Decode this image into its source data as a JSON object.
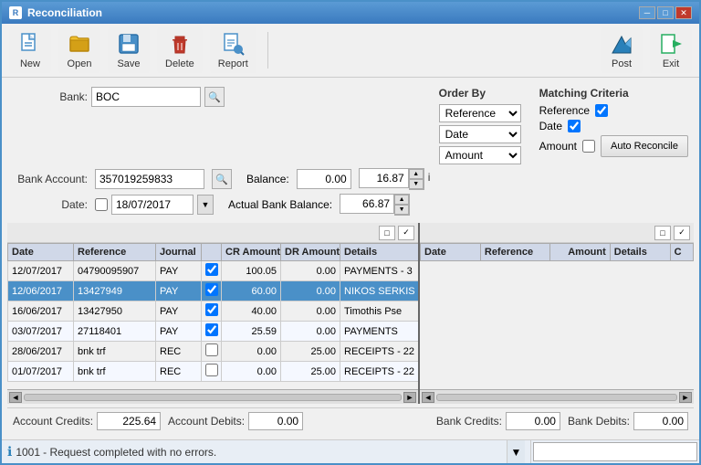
{
  "window": {
    "title": "Reconciliation"
  },
  "toolbar": {
    "new_label": "New",
    "open_label": "Open",
    "save_label": "Save",
    "delete_label": "Delete",
    "report_label": "Report",
    "post_label": "Post",
    "exit_label": "Exit"
  },
  "form": {
    "bank_label": "Bank:",
    "bank_value": "BOC",
    "bank_account_label": "Bank Account:",
    "bank_account_value": "357019259833",
    "date_label": "Date:",
    "date_value": "18/07/2017",
    "balance_label": "Balance:",
    "balance_value": "0.00",
    "balance_value2": "16.87",
    "actual_bank_balance_label": "Actual Bank Balance:",
    "actual_bank_balance_value": "66.87"
  },
  "order_by": {
    "title": "Order By",
    "options": [
      "Reference",
      "Date",
      "Amount"
    ],
    "selected": [
      "Reference",
      "Date",
      "Amount"
    ]
  },
  "matching_criteria": {
    "title": "Matching Criteria",
    "items": [
      {
        "label": "Reference",
        "checked": true
      },
      {
        "label": "Date",
        "checked": true
      },
      {
        "label": "Amount",
        "checked": false
      }
    ],
    "auto_reconcile_label": "Auto Reconcile"
  },
  "left_table": {
    "headers": [
      "Date",
      "Reference",
      "Journal",
      "",
      "CR Amount",
      "DR Amount",
      "Details"
    ],
    "rows": [
      {
        "date": "12/07/2017",
        "reference": "04790095907",
        "journal": "PAY",
        "checked": true,
        "cr_amount": "100.05",
        "dr_amount": "0.00",
        "details": "PAYMENTS - 3",
        "selected": false
      },
      {
        "date": "12/06/2017",
        "reference": "13427949",
        "journal": "PAY",
        "checked": true,
        "cr_amount": "60.00",
        "dr_amount": "0.00",
        "details": "NIKOS SERKIS",
        "selected": true
      },
      {
        "date": "16/06/2017",
        "reference": "13427950",
        "journal": "PAY",
        "checked": true,
        "cr_amount": "40.00",
        "dr_amount": "0.00",
        "details": "Timothis Pse",
        "selected": false
      },
      {
        "date": "03/07/2017",
        "reference": "27118401",
        "journal": "PAY",
        "checked": true,
        "cr_amount": "25.59",
        "dr_amount": "0.00",
        "details": "PAYMENTS",
        "selected": false
      },
      {
        "date": "28/06/2017",
        "reference": "bnk trf",
        "journal": "REC",
        "checked": false,
        "cr_amount": "0.00",
        "dr_amount": "25.00",
        "details": "RECEIPTS - 22",
        "selected": false
      },
      {
        "date": "01/07/2017",
        "reference": "bnk trf",
        "journal": "REC",
        "checked": false,
        "cr_amount": "0.00",
        "dr_amount": "25.00",
        "details": "RECEIPTS - 22",
        "selected": false
      }
    ]
  },
  "right_table": {
    "headers": [
      "Date",
      "Reference",
      "Amount",
      "Details",
      "C"
    ],
    "rows": []
  },
  "footer": {
    "account_credits_label": "Account Credits:",
    "account_credits_value": "225.64",
    "account_debits_label": "Account Debits:",
    "account_debits_value": "0.00",
    "bank_credits_label": "Bank Credits:",
    "bank_credits_value": "0.00",
    "bank_debits_label": "Bank Debits:",
    "bank_debits_value": "0.00"
  },
  "status": {
    "icon": "ℹ",
    "code": "1001",
    "message": "Request completed with no errors."
  }
}
